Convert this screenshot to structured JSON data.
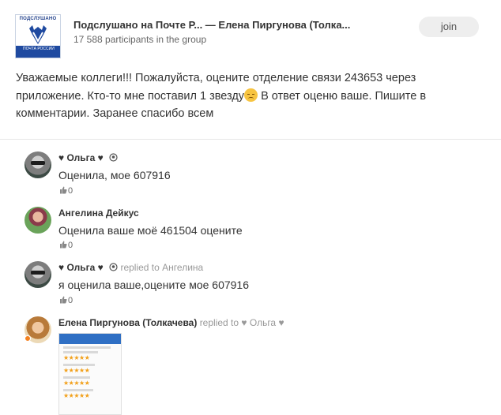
{
  "group": {
    "logo_text": "ПОДСЛУШАНО",
    "logo_brand": "ПОЧТА РОССИИ",
    "title": "Подслушано на Почте Р...",
    "title_sep": " — ",
    "author": "Елена Пиргунова (Толка...",
    "participants": "17 588 participants in the group",
    "join_label": "join"
  },
  "post": {
    "text_before_emoji": "Уважаемые коллеги!!! Пожалуйста, оцените отделение связи 243653 через приложение. Кто-то мне поставил 1 звезду",
    "emoji": "pensive-face-emoji",
    "text_after_emoji": "  В ответ оценю ваше. Пишите в комментарии. Заранее спасибо всем"
  },
  "comments": [
    {
      "author": "♥ Ольга ♥",
      "replied_label": "",
      "reply_target": "",
      "text": "Оценила, мое 607916",
      "likes": "0"
    },
    {
      "author": "Ангелина Дейкус",
      "replied_label": "",
      "reply_target": "",
      "text": "Оценила ваше моё 461504 оцените",
      "likes": "0"
    },
    {
      "author": "♥ Ольга ♥",
      "replied_label": "replied to",
      "reply_target": "Ангелина",
      "text": "я оценила ваше,оцените мое 607916",
      "likes": "0"
    },
    {
      "author": "Елена Пиргунова (Толкачева)",
      "replied_label": "replied to",
      "reply_target": "♥ Ольга ♥",
      "text": "",
      "likes": ""
    }
  ],
  "icons": {
    "like": "thumbs-up-icon",
    "badge": "badge-icon",
    "online": "online-indicator-icon"
  },
  "colors": {
    "accent_orange": "#f58220",
    "join_bg": "#eeeeee",
    "muted": "#999999",
    "star": "#f2a01a",
    "app_bar": "#2f6fc4"
  }
}
